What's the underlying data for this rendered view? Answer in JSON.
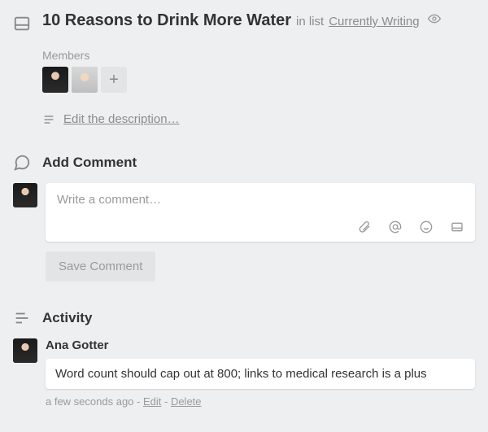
{
  "header": {
    "title": "10 Reasons to Drink More Water",
    "in_list_prefix": "in list",
    "list_name": "Currently Writing"
  },
  "members": {
    "label": "Members"
  },
  "description": {
    "link_text": "Edit the description…"
  },
  "add_comment": {
    "heading": "Add Comment",
    "placeholder": "Write a comment…",
    "save_label": "Save Comment"
  },
  "activity": {
    "heading": "Activity",
    "entries": [
      {
        "author": "Ana Gotter",
        "text": "Word count should cap out at 800; links to medical research is a plus",
        "time": "a few seconds ago",
        "sep1": " - ",
        "edit": "Edit",
        "sep2": " - ",
        "delete": "Delete"
      }
    ]
  }
}
